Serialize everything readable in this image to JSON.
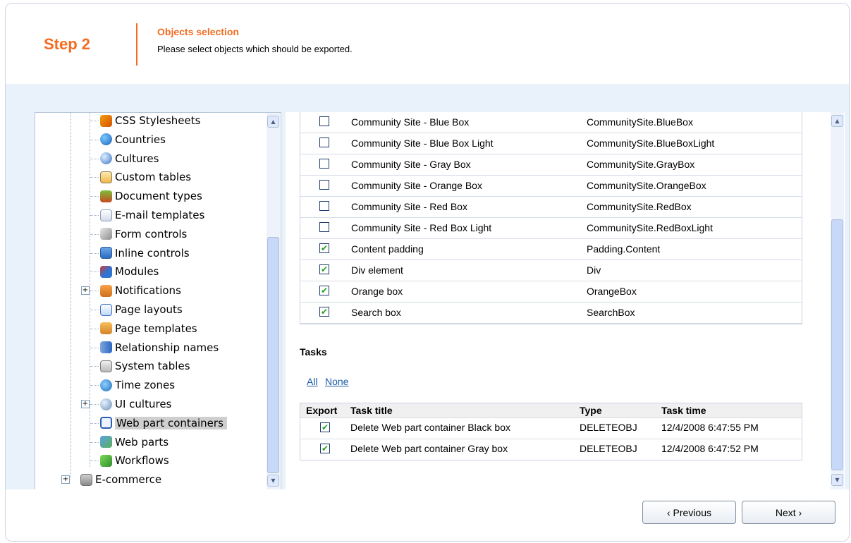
{
  "header": {
    "step_label": "Step 2",
    "title": "Objects selection",
    "description": "Please select objects which should be exported."
  },
  "tree": {
    "items": [
      {
        "label": "CSS Stylesheets",
        "icon": "css-stylesheets-icon"
      },
      {
        "label": "Countries",
        "icon": "globe-icon"
      },
      {
        "label": "Cultures",
        "icon": "cultures-globe-icon"
      },
      {
        "label": "Custom tables",
        "icon": "table-icon"
      },
      {
        "label": "Document types",
        "icon": "document-types-icon"
      },
      {
        "label": "E-mail templates",
        "icon": "email-icon"
      },
      {
        "label": "Form controls",
        "icon": "form-controls-icon"
      },
      {
        "label": "Inline controls",
        "icon": "inline-controls-icon"
      },
      {
        "label": "Modules",
        "icon": "modules-icon"
      },
      {
        "label": "Notifications",
        "icon": "notifications-icon"
      },
      {
        "label": "Page layouts",
        "icon": "page-layouts-icon"
      },
      {
        "label": "Page templates",
        "icon": "page-templates-icon"
      },
      {
        "label": "Relationship names",
        "icon": "relationship-icon"
      },
      {
        "label": "System tables",
        "icon": "system-tables-icon"
      },
      {
        "label": "Time zones",
        "icon": "clock-icon"
      },
      {
        "label": "UI cultures",
        "icon": "ui-cultures-icon"
      },
      {
        "label": "Web part containers",
        "icon": "web-part-containers-icon"
      },
      {
        "label": "Web parts",
        "icon": "web-parts-icon"
      },
      {
        "label": "Workflows",
        "icon": "checkmark-icon"
      }
    ],
    "ecommerce": {
      "label": "E-commerce",
      "icon": "ecommerce-icon"
    }
  },
  "objects": {
    "rows": [
      {
        "checked": false,
        "title": "Community Site - Blue Box",
        "code": "CommunitySite.BlueBox"
      },
      {
        "checked": false,
        "title": "Community Site - Blue Box Light",
        "code": "CommunitySite.BlueBoxLight"
      },
      {
        "checked": false,
        "title": "Community Site - Gray Box",
        "code": "CommunitySite.GrayBox"
      },
      {
        "checked": false,
        "title": "Community Site - Orange Box",
        "code": "CommunitySite.OrangeBox"
      },
      {
        "checked": false,
        "title": "Community Site - Red Box",
        "code": "CommunitySite.RedBox"
      },
      {
        "checked": false,
        "title": "Community Site - Red Box Light",
        "code": "CommunitySite.RedBoxLight"
      },
      {
        "checked": true,
        "title": "Content padding",
        "code": "Padding.Content"
      },
      {
        "checked": true,
        "title": "Div element",
        "code": "Div"
      },
      {
        "checked": true,
        "title": "Orange box",
        "code": "OrangeBox"
      },
      {
        "checked": true,
        "title": "Search box",
        "code": "SearchBox"
      }
    ]
  },
  "tasks": {
    "title": "Tasks",
    "all_label": "All",
    "none_label": "None",
    "columns": [
      "Export",
      "Task title",
      "Type",
      "Task time"
    ],
    "rows": [
      {
        "checked": true,
        "title": "Delete Web part container Black box",
        "type": "DELETEOBJ",
        "time": "12/4/2008 6:47:55 PM"
      },
      {
        "checked": true,
        "title": "Delete Web part container Gray box",
        "type": "DELETEOBJ",
        "time": "12/4/2008 6:47:52 PM"
      }
    ]
  },
  "footer": {
    "previous_label": "‹ Previous",
    "next_label": "Next ›"
  },
  "colors": {
    "accent": "#f36c21",
    "link": "#1a5aa6",
    "background": "#e9f2fb"
  }
}
